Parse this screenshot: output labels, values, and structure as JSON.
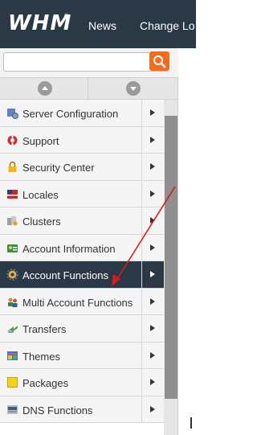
{
  "header": {
    "logo_text": "WHM",
    "logo_mark": "®",
    "nav": [
      "News",
      "Change Lo"
    ]
  },
  "search": {
    "value": "",
    "placeholder": "",
    "button_icon": "search-icon"
  },
  "collapse": {
    "left_icon": "expand-up-icon",
    "right_icon": "collapse-down-icon"
  },
  "menu": {
    "items": [
      {
        "label": "Server Configuration",
        "icon": "server-config-icon"
      },
      {
        "label": "Support",
        "icon": "lifebuoy-icon"
      },
      {
        "label": "Security Center",
        "icon": "lock-icon"
      },
      {
        "label": "Locales",
        "icon": "flag-icon"
      },
      {
        "label": "Clusters",
        "icon": "clusters-icon"
      },
      {
        "label": "Account Information",
        "icon": "account-info-icon"
      },
      {
        "label": "Account Functions",
        "icon": "account-functions-icon",
        "active": true
      },
      {
        "label": "Multi Account Functions",
        "icon": "multi-account-icon"
      },
      {
        "label": "Transfers",
        "icon": "transfers-icon"
      },
      {
        "label": "Themes",
        "icon": "themes-icon"
      },
      {
        "label": "Packages",
        "icon": "package-icon"
      },
      {
        "label": "DNS Functions",
        "icon": "dns-icon"
      }
    ]
  },
  "colors": {
    "header_bg": "#2b3846",
    "active_bg": "#2b3846",
    "search_button": "#f46d1f",
    "annotation_arrow": "#d81c1c"
  }
}
